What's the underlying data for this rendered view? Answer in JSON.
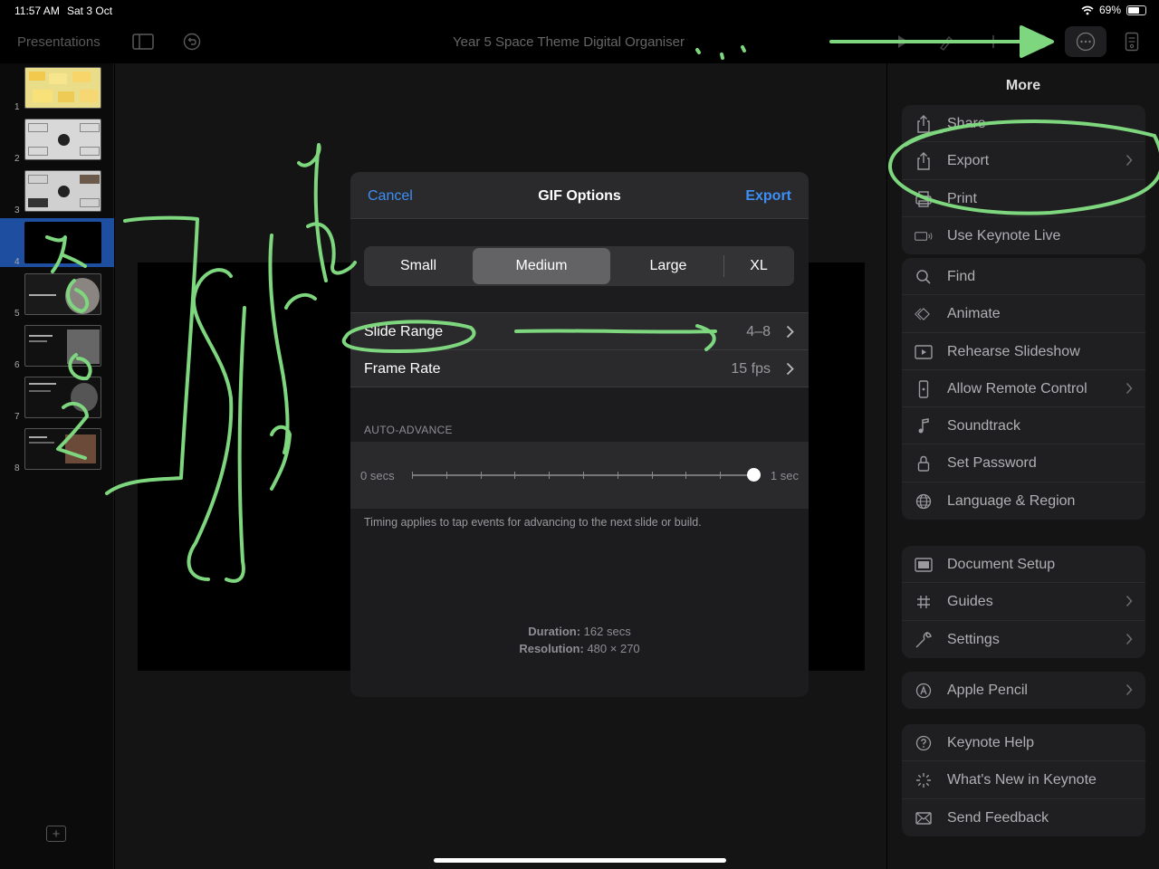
{
  "status_bar": {
    "time": "11:57 AM",
    "date": "Sat 3 Oct",
    "battery": "69%",
    "battery_level": 0.69
  },
  "toolbar": {
    "presentations_label": "Presentations",
    "document_title": "Year 5 Space Theme Digital Organiser"
  },
  "sidebar": {
    "slides": [
      {
        "number": "1",
        "selected": false
      },
      {
        "number": "2",
        "selected": false
      },
      {
        "number": "3",
        "selected": false
      },
      {
        "number": "4",
        "selected": true
      },
      {
        "number": "5",
        "selected": false
      },
      {
        "number": "6",
        "selected": false
      },
      {
        "number": "7",
        "selected": false
      },
      {
        "number": "8",
        "selected": false
      }
    ],
    "add_slide_label": "+"
  },
  "dialog": {
    "cancel_label": "Cancel",
    "title": "GIF Options",
    "export_label": "Export",
    "sizes": [
      "Small",
      "Medium",
      "Large",
      "XL"
    ],
    "selected_size": "Medium",
    "slide_range_label": "Slide Range",
    "slide_range_value": "4–8",
    "frame_rate_label": "Frame Rate",
    "frame_rate_value": "15 fps",
    "auto_advance_header": "AUTO-ADVANCE",
    "slider_min_label": "0 secs",
    "slider_max_label": "1 sec",
    "slider_value": 1.0,
    "footnote": "Timing applies to tap events for advancing to the next slide or build.",
    "duration_label": "Duration:",
    "duration_value": "162 secs",
    "resolution_label": "Resolution:",
    "resolution_value": "480 × 270"
  },
  "more_panel": {
    "title": "More",
    "groups": [
      [
        {
          "label": "Share",
          "icon": "share-icon",
          "chevron": false
        },
        {
          "label": "Export",
          "icon": "export-icon",
          "chevron": true
        },
        {
          "label": "Print",
          "icon": "print-icon",
          "chevron": false
        },
        {
          "label": "Use Keynote Live",
          "icon": "keynote-live-icon",
          "chevron": false
        }
      ],
      [
        {
          "label": "Find",
          "icon": "search-icon",
          "chevron": false
        },
        {
          "label": "Animate",
          "icon": "animate-icon",
          "chevron": false
        },
        {
          "label": "Rehearse Slideshow",
          "icon": "play-icon",
          "chevron": false
        },
        {
          "label": "Allow Remote Control",
          "icon": "remote-icon",
          "chevron": true
        },
        {
          "label": "Soundtrack",
          "icon": "music-note-icon",
          "chevron": false
        },
        {
          "label": "Set Password",
          "icon": "lock-icon",
          "chevron": false
        },
        {
          "label": "Language & Region",
          "icon": "globe-icon",
          "chevron": false
        }
      ],
      [
        {
          "label": "Document Setup",
          "icon": "document-setup-icon",
          "chevron": false
        },
        {
          "label": "Guides",
          "icon": "grid-icon",
          "chevron": true
        },
        {
          "label": "Settings",
          "icon": "wrench-icon",
          "chevron": true
        }
      ],
      [
        {
          "label": "Apple Pencil",
          "icon": "pencil-icon",
          "chevron": true
        }
      ],
      [
        {
          "label": "Keynote Help",
          "icon": "help-icon",
          "chevron": false
        },
        {
          "label": "What's New in Keynote",
          "icon": "sparkle-icon",
          "chevron": false
        },
        {
          "label": "Send Feedback",
          "icon": "mail-icon",
          "chevron": false
        }
      ]
    ]
  },
  "colors": {
    "accent": "#3d8ff5",
    "annotation": "#7ed67e",
    "selected_slide": "#1e4ea0"
  }
}
